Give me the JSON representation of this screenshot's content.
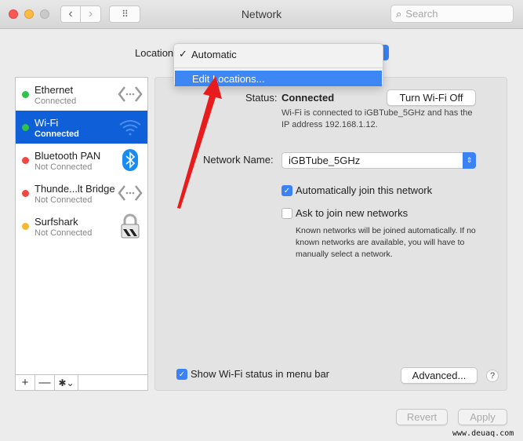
{
  "window": {
    "title": "Network",
    "search_placeholder": "Search",
    "nav_back_glyph": "‹",
    "nav_forward_glyph": "›",
    "grid_glyph": "⠿"
  },
  "location": {
    "label": "Location",
    "menu": {
      "items": [
        {
          "label": "Automatic",
          "checked": true,
          "check_glyph": "✓"
        },
        {
          "label": "Edit Locations...",
          "highlighted": true
        }
      ]
    }
  },
  "sidebar": {
    "services": [
      {
        "name": "Ethernet",
        "status": "Connected",
        "dot_color": "#2ec24a",
        "icon": "ethernet-icon",
        "selected": false
      },
      {
        "name": "Wi-Fi",
        "status": "Connected",
        "dot_color": "#2ec24a",
        "icon": "wifi-icon",
        "selected": true
      },
      {
        "name": "Bluetooth PAN",
        "status": "Not Connected",
        "dot_color": "#f0473f",
        "icon": "bluetooth-icon",
        "selected": false
      },
      {
        "name": "Thunde...lt Bridge",
        "status": "Not Connected",
        "dot_color": "#f0473f",
        "icon": "thunderbolt-bridge-icon",
        "selected": false
      },
      {
        "name": "Surfshark",
        "status": "Not Connected",
        "dot_color": "#f5b82e",
        "icon": "vpn-lock-icon",
        "selected": false
      }
    ],
    "add_glyph": "+",
    "remove_glyph": "—",
    "gear_glyph": "✱⌄"
  },
  "detail": {
    "status_label": "Status:",
    "status_value": "Connected",
    "status_description": "Wi-Fi is connected to iGBTube_5GHz and has the IP address 192.168.1.12.",
    "turn_off_button": "Turn Wi-Fi Off",
    "network_name_label": "Network Name:",
    "network_name_value": "iGBTube_5GHz",
    "stepper_glyph": "⇕",
    "auto_join": {
      "label": "Automatically join this network",
      "checked": true
    },
    "ask_join": {
      "label": "Ask to join new networks",
      "checked": false
    },
    "ask_description": "Known networks will be joined automatically. If no known networks are available, you will have to manually select a network.",
    "show_status": {
      "label": "Show Wi-Fi status in menu bar",
      "checked": true
    },
    "advanced_button": "Advanced...",
    "help_glyph": "?",
    "check_glyph": "✓"
  },
  "footer": {
    "revert_button": "Revert",
    "apply_button": "Apply"
  },
  "watermark": "www.deuaq.com",
  "colors": {
    "accent": "#3b82f6",
    "selection": "#0e5fd8",
    "annotation_arrow": "#e81c1c"
  }
}
